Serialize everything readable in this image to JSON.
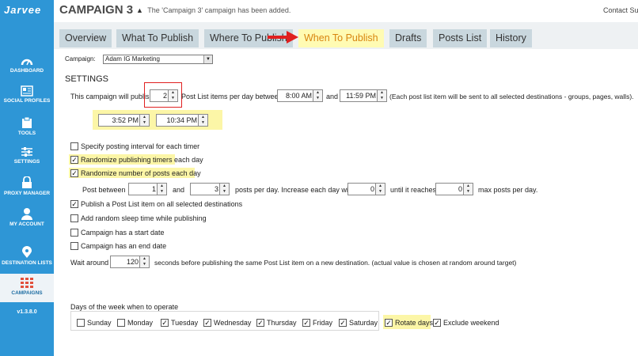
{
  "app": {
    "logo": "Jarvee",
    "version": "v1.3.8.0"
  },
  "header": {
    "title": "CAMPAIGN 3",
    "notification": "The 'Campaign 3' campaign has been added.",
    "contact": "Contact Su"
  },
  "sidebar": {
    "items": [
      {
        "label": "DASHBOARD",
        "icon": "dashboard-icon"
      },
      {
        "label": "SOCIAL PROFILES",
        "icon": "social-profiles-icon"
      },
      {
        "label": "TOOLS",
        "icon": "tools-icon"
      },
      {
        "label": "SETTINGS",
        "icon": "settings-icon"
      },
      {
        "label": "PROXY MANAGER",
        "icon": "proxy-manager-icon"
      },
      {
        "label": "MY ACCOUNT",
        "icon": "account-icon"
      },
      {
        "label": "DESTINATION LISTS",
        "icon": "destination-lists-icon"
      },
      {
        "label": "CAMPAIGNS",
        "icon": "campaigns-icon",
        "active": true
      }
    ]
  },
  "tabs": [
    {
      "label": "Overview"
    },
    {
      "label": "What To Publish"
    },
    {
      "label": "Where To Publish"
    },
    {
      "label": "When To Publish",
      "active": true
    },
    {
      "label": "Drafts"
    },
    {
      "label": "Posts List"
    },
    {
      "label": "History"
    }
  ],
  "campaign": {
    "label": "Campaign:",
    "selected": "Adam IG Marketing"
  },
  "settings": {
    "heading": "SETTINGS",
    "publish_prefix": "This campaign will publish",
    "publish_count": "2",
    "publish_between": "Post List items per day between",
    "start_time": "8:00 AM",
    "and": "and",
    "end_time": "11:59 PM",
    "publish_note": "(Each post list item will be sent to all selected destinations - groups, pages, walls).",
    "timer1": "3:52 PM",
    "timer2": "10:34 PM"
  },
  "options": {
    "interval": {
      "label": "Specify posting interval for each timer",
      "checked": false
    },
    "randomize_timers": {
      "label": "Randomize publishing timers each day",
      "checked": true
    },
    "randomize_posts": {
      "label": "Randomize number of posts each day",
      "checked": true
    },
    "post_between": {
      "prefix": "Post between",
      "min": "1",
      "and": "and",
      "max": "3",
      "mid": "posts per day.  Increase each day with",
      "increase": "0",
      "until": "until it reaches",
      "limit": "0",
      "suffix": "max posts per day."
    },
    "publish_all": {
      "label": "Publish a Post List item on all selected destinations",
      "checked": true
    },
    "random_sleep": {
      "label": "Add random sleep time while publishing",
      "checked": false
    },
    "start_date": {
      "label": "Campaign has a start date",
      "checked": false
    },
    "end_date": {
      "label": "Campaign has an end date",
      "checked": false
    },
    "wait": {
      "prefix": "Wait around",
      "seconds": "120",
      "suffix": "seconds before publishing the same Post List item on a new destination. (actual value is chosen at random around target)"
    }
  },
  "days": {
    "label": "Days of the week when to operate",
    "items": [
      {
        "label": "Sunday",
        "checked": false
      },
      {
        "label": "Monday",
        "checked": false
      },
      {
        "label": "Tuesday",
        "checked": true
      },
      {
        "label": "Wednesday",
        "checked": true
      },
      {
        "label": "Thursday",
        "checked": true
      },
      {
        "label": "Friday",
        "checked": true
      },
      {
        "label": "Saturday",
        "checked": true
      }
    ],
    "rotate": {
      "label": "Rotate days",
      "checked": true
    },
    "exclude_weekend": {
      "label": "Exclude weekend",
      "checked": true
    }
  },
  "colors": {
    "sidebar": "#2e96d6",
    "highlight": "#fcf6a7",
    "active_tab_text": "#d8850f",
    "annotation": "#e02020"
  }
}
